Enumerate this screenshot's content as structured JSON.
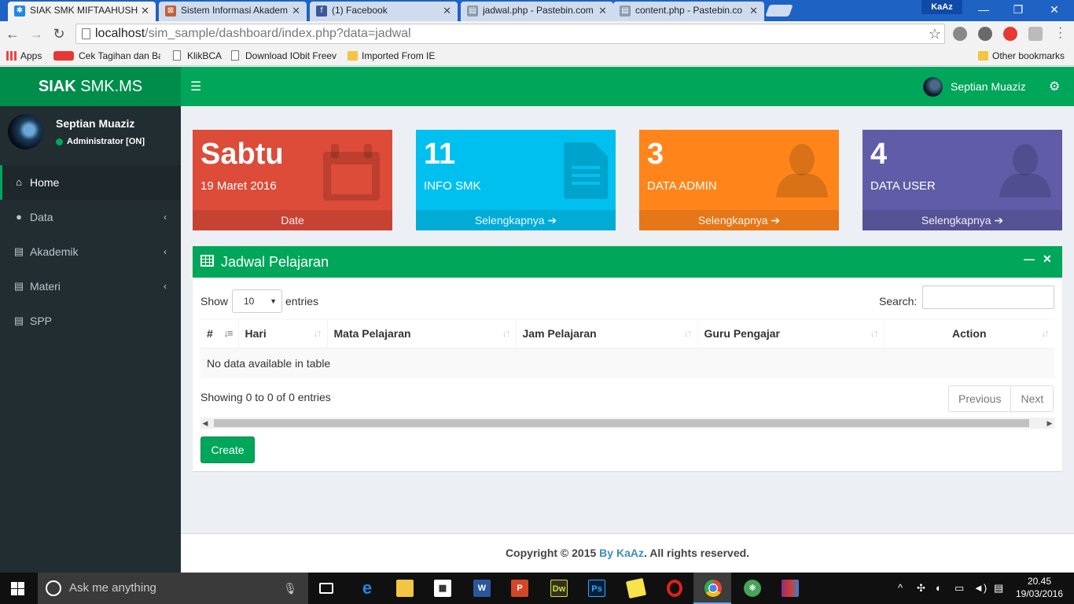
{
  "browser": {
    "tabs": [
      {
        "title": "SIAK SMK MIFTAAHUSH S",
        "active": true
      },
      {
        "title": "Sistem Informasi Akadem",
        "active": false
      },
      {
        "title": "(1) Facebook",
        "active": false
      },
      {
        "title": "jadwal.php - Pastebin.com",
        "active": false
      },
      {
        "title": "content.php - Pastebin.co",
        "active": false
      }
    ],
    "profile": "KaAz",
    "url_host": "localhost",
    "url_path": "/sim_sample/dashboard/index.php?data=jadwal",
    "bookmarks": [
      "Apps",
      "Cek Tagihan dan Ba",
      "KlikBCA",
      "Download IObit Freev",
      "Imported From IE"
    ],
    "other_bookmarks": "Other bookmarks"
  },
  "header": {
    "logo_bold": "SIAK",
    "logo_rest": " SMK.MS",
    "user_name": "Septian Muaziz"
  },
  "sidebar": {
    "user_name": "Septian Muaziz",
    "user_status": "Administrator [ON]",
    "items": [
      {
        "label": "Home",
        "icon": "home-icon",
        "active": true
      },
      {
        "label": "Data",
        "icon": "user-icon",
        "active": false
      },
      {
        "label": "Akademik",
        "icon": "file-icon",
        "active": false
      },
      {
        "label": "Materi",
        "icon": "file-icon",
        "active": false
      },
      {
        "label": "SPP",
        "icon": "file-icon",
        "active": false
      }
    ]
  },
  "stat_boxes": [
    {
      "big": "Sabtu",
      "sub": "19 Maret 2016",
      "footer": "Date",
      "color": "#dd4b39",
      "icon": "calendar-icon"
    },
    {
      "big": "11",
      "sub": "INFO SMK",
      "footer": "Selengkapnya",
      "color": "#00c0ef",
      "icon": "document-icon"
    },
    {
      "big": "3",
      "sub": "DATA ADMIN",
      "footer": "Selengkapnya",
      "color": "#ff851b",
      "icon": "person-icon"
    },
    {
      "big": "4",
      "sub": "DATA USER",
      "footer": "Selengkapnya",
      "color": "#605ca8",
      "icon": "person-icon"
    }
  ],
  "panel": {
    "title": "Jadwal Pelajaran",
    "show_label": "Show",
    "page_size": "10",
    "entries_label": "entries",
    "search_label": "Search:",
    "columns": [
      "#",
      "Hari",
      "Mata Pelajaran",
      "Jam Pelajaran",
      "Guru Pengajar",
      "Action"
    ],
    "empty_message": "No data available in table",
    "info": "Showing 0 to 0 of 0 entries",
    "prev": "Previous",
    "next": "Next",
    "create": "Create"
  },
  "footer": {
    "prefix": "Copyright © 2015 ",
    "link": "By KaAz",
    "suffix": ". All rights reserved."
  },
  "taskbar": {
    "search_placeholder": "Ask me anything",
    "time": "20.45",
    "date": "19/03/2016"
  },
  "colors": {
    "brand_green": "#00a65a",
    "sidebar_bg": "#222d32"
  }
}
